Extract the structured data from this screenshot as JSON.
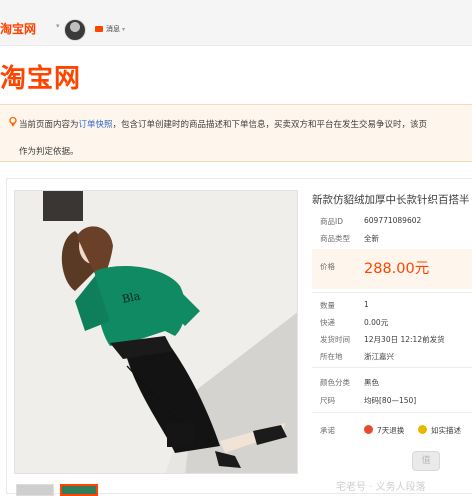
{
  "topbar": {
    "logo": "淘宝网",
    "messages_label": "消息"
  },
  "header": {
    "logo": "淘宝网"
  },
  "notice": {
    "prefix": "当前页面内容为",
    "link": "订单快照",
    "text": "，包含订单创建时的商品描述和下单信息，买卖双方和平台在发生交易争议时，该页",
    "line2": "作为判定依据。"
  },
  "product": {
    "title": "新款仿貂绒加厚中长款针织百搭半",
    "rows": [
      {
        "label": "商品ID",
        "value": "609771089602"
      },
      {
        "label": "商品类型",
        "value": "全新"
      }
    ],
    "price_label": "价格",
    "price": "288.00元",
    "details": [
      {
        "label": "数量",
        "value": "1"
      },
      {
        "label": "快递",
        "value": "0.00元"
      },
      {
        "label": "发货时间",
        "value": "12月30日 12:12前发货"
      },
      {
        "label": "所在地",
        "value": "浙江嘉兴"
      }
    ],
    "options": [
      {
        "label": "颜色分类",
        "value": "黑色"
      },
      {
        "label": "尺码",
        "value": "均码[80—150]"
      }
    ],
    "promise_label": "承诺",
    "services": [
      "7天退换",
      "如实描述"
    ]
  },
  "photo_print": "Bla",
  "watermark": {
    "badge": "值",
    "text": "宅老号 · 义务人段落"
  },
  "colors": {
    "brand": "#ff4400",
    "link": "#3366cc",
    "notice_bg": "#fef6ec"
  }
}
